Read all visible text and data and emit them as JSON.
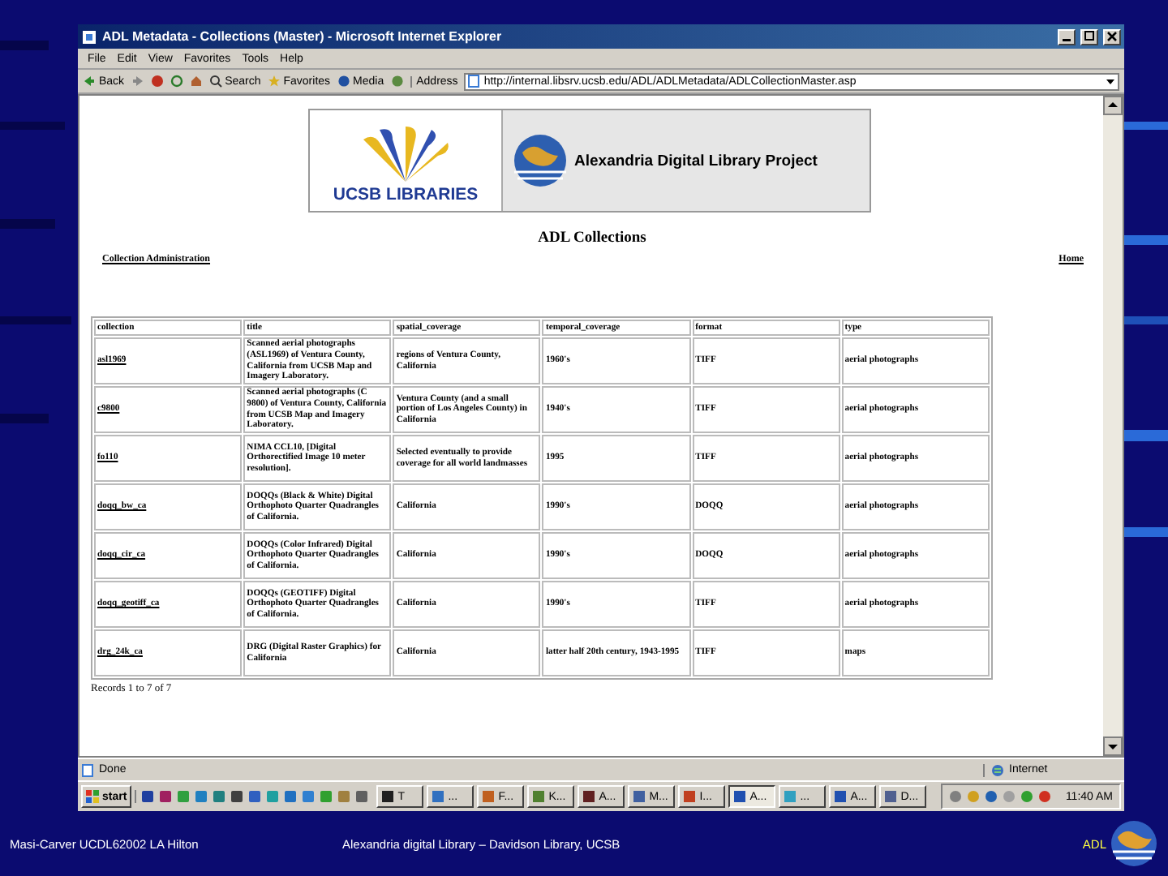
{
  "window": {
    "title": "ADL Metadata - Collections (Master) - Microsoft Internet Explorer"
  },
  "menu": [
    {
      "label": "File"
    },
    {
      "label": "Edit"
    },
    {
      "label": "View"
    },
    {
      "label": "Favorites"
    },
    {
      "label": "Tools"
    },
    {
      "label": "Help"
    }
  ],
  "toolbar": {
    "back": "Back",
    "search": "Search",
    "favorites": "Favorites",
    "media": "Media",
    "address_label": "Address",
    "address": "http://internal.libsrv.ucsb.edu/ADL/ADLMetadata/ADLCollectionMaster.asp"
  },
  "page": {
    "logo": {
      "left": "UCSB LIBRARIES",
      "right": "Alexandria Digital Library Project"
    },
    "heading": "ADL Collections",
    "links": {
      "left": "Collection Administration",
      "right": "Home"
    },
    "table": {
      "columns": [
        "collection",
        "title",
        "spatial_coverage",
        "temporal_coverage",
        "format",
        "type"
      ],
      "rows": [
        {
          "collection": "asl1969",
          "title": "Scanned aerial photographs (ASL1969) of Ventura County, California from UCSB Map and Imagery Laboratory.",
          "spatial_coverage": "regions of Ventura County, California",
          "temporal_coverage": "1960's",
          "format": "TIFF",
          "type": "aerial photographs"
        },
        {
          "collection": "c9800",
          "title": "Scanned aerial photographs (C 9800) of Ventura County, California from UCSB Map and Imagery Laboratory.",
          "spatial_coverage": "Ventura County (and a small portion of Los Angeles County) in California",
          "temporal_coverage": "1940's",
          "format": "TIFF",
          "type": "aerial photographs"
        },
        {
          "collection": "fo110",
          "title": "NIMA CCL10, [Digital Orthorectified Image 10 meter resolution].",
          "spatial_coverage": "Selected eventually to provide coverage for all world landmasses",
          "temporal_coverage": "1995",
          "format": "TIFF",
          "type": "aerial photographs"
        },
        {
          "collection": "doqq_bw_ca",
          "title": "DOQQs (Black & White) Digital Orthophoto Quarter Quadrangles of California.",
          "spatial_coverage": "California",
          "temporal_coverage": "1990's",
          "format": "DOQQ",
          "type": "aerial photographs"
        },
        {
          "collection": "doqq_cir_ca",
          "title": "DOQQs (Color Infrared) Digital Orthophoto Quarter Quadrangles of California.",
          "spatial_coverage": "California",
          "temporal_coverage": "1990's",
          "format": "DOQQ",
          "type": "aerial photographs"
        },
        {
          "collection": "doqq_geotiff_ca",
          "title": "DOQQs (GEOTIFF) Digital Orthophoto Quarter Quadrangles of California.",
          "spatial_coverage": "California",
          "temporal_coverage": "1990's",
          "format": "TIFF",
          "type": "aerial photographs"
        },
        {
          "collection": "drg_24k_ca",
          "title": "DRG (Digital Raster Graphics) for California",
          "spatial_coverage": "California",
          "temporal_coverage": "latter half 20th century, 1943-1995",
          "format": "TIFF",
          "type": "maps"
        }
      ]
    },
    "records": "Records 1 to 7 of 7"
  },
  "status_bar": {
    "text": "Done",
    "zone": "Internet"
  },
  "taskbar": {
    "start": "start",
    "tasks": [
      {
        "label": "T",
        "selected": false
      },
      {
        "label": "...",
        "selected": false
      },
      {
        "label": "F...",
        "selected": false
      },
      {
        "label": "K...",
        "selected": false
      },
      {
        "label": "A...",
        "selected": false
      },
      {
        "label": "M...",
        "selected": false
      },
      {
        "label": "I...",
        "selected": false
      },
      {
        "label": "A...",
        "selected": true
      },
      {
        "label": "...",
        "selected": false
      },
      {
        "label": "A...",
        "selected": false
      },
      {
        "label": "D...",
        "selected": false
      }
    ],
    "clock": "11:40 AM"
  },
  "slide_footer": {
    "left": "Masi-Carver UCDL62002 LA Hilton",
    "center": "Alexandria digital Library – Davidson Library, UCSB",
    "right": "ADL"
  }
}
